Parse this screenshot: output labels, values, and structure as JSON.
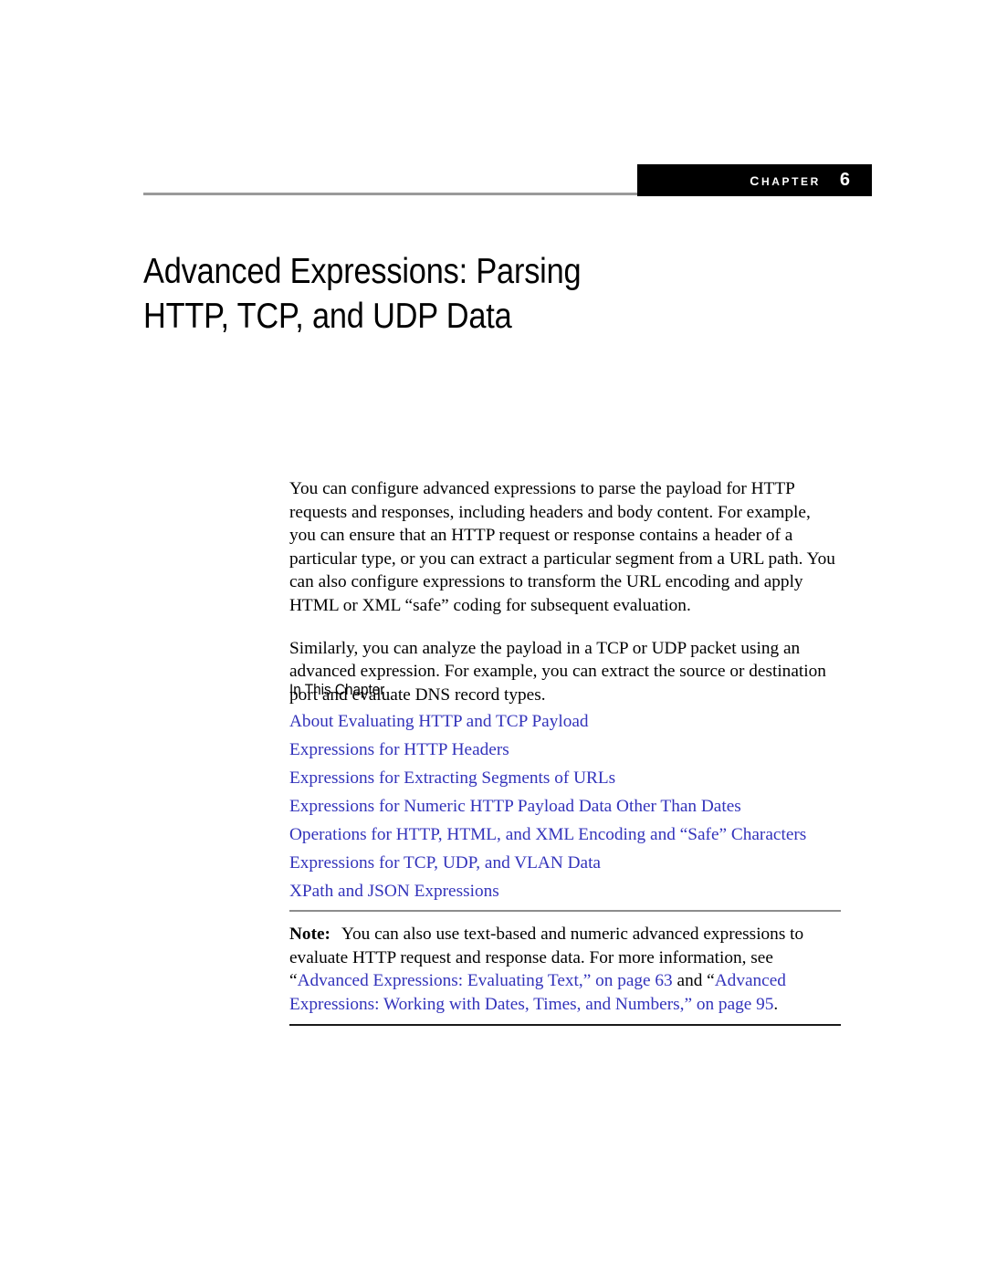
{
  "page": {
    "background_color": "#ffffff",
    "link_color": "#3333bb",
    "text_color": "#000000",
    "rule_color": "#9a9a9a"
  },
  "chapter_header": {
    "badge_word": "Chapter",
    "badge_number": "6",
    "badge_background": "#000000",
    "badge_text_color": "#ffffff"
  },
  "title": {
    "line1": "Advanced Expressions: Parsing",
    "line2": "HTTP, TCP, and UDP Data",
    "full": "Advanced Expressions: Parsing HTTP, TCP, and UDP Data"
  },
  "intro": {
    "paragraph1": "You can configure advanced expressions to parse the payload for HTTP requests and responses, including headers and body content. For example, you can ensure that an HTTP request or response contains a header of a particular type, or you can extract a particular segment from a URL path. You can also configure expressions to transform the URL encoding and apply HTML or XML “safe” coding for subsequent evaluation.",
    "paragraph2": "Similarly, you can analyze the payload in a TCP or UDP packet using an advanced expression. For example, you can extract the source or destination port and evaluate DNS record types."
  },
  "in_this_chapter": {
    "heading": "In This Chapter",
    "items": [
      {
        "label": "About Evaluating HTTP and TCP Payload"
      },
      {
        "label": "Expressions for HTTP Headers"
      },
      {
        "label": "Expressions for Extracting Segments of URLs"
      },
      {
        "label": "Expressions for Numeric HTTP Payload Data Other Than Dates"
      },
      {
        "label": "Operations for HTTP, HTML, and XML Encoding and “Safe” Characters"
      },
      {
        "label": "Expressions for TCP, UDP, and VLAN Data"
      },
      {
        "label": "XPath and JSON Expressions"
      }
    ]
  },
  "note": {
    "label": "Note:",
    "text_part1": "You can also use text-based and numeric advanced expressions to evaluate HTTP request and response data. For more information, see “",
    "link1": "Advanced Expressions: Evaluating Text,” on page 63",
    "text_part2": " and “",
    "link2": "Advanced Expressions: Working with Dates, Times, and Numbers,” on page 95",
    "text_part3": "."
  }
}
